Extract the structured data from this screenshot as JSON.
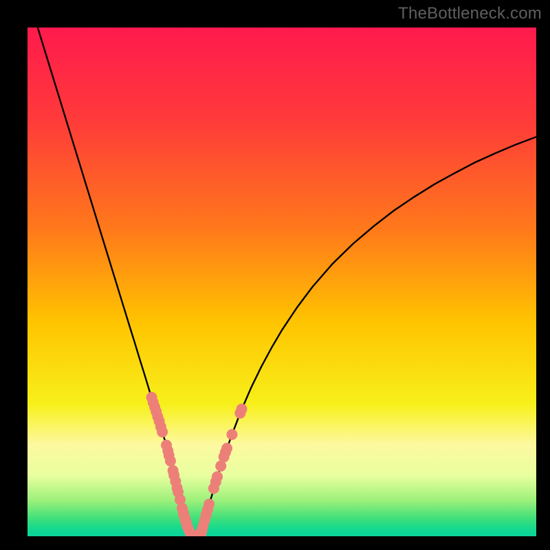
{
  "watermark": "TheBottleneck.com",
  "chart_data": {
    "type": "line",
    "title": "",
    "xlabel": "",
    "ylabel": "",
    "xlim": [
      0,
      100
    ],
    "ylim": [
      0,
      100
    ],
    "background_gradient": {
      "stops": [
        {
          "offset": 0.0,
          "color": "#ff1a4d"
        },
        {
          "offset": 0.18,
          "color": "#ff3a3a"
        },
        {
          "offset": 0.4,
          "color": "#ff7a1a"
        },
        {
          "offset": 0.58,
          "color": "#ffc400"
        },
        {
          "offset": 0.74,
          "color": "#f7f01a"
        },
        {
          "offset": 0.82,
          "color": "#fdf9a0"
        },
        {
          "offset": 0.88,
          "color": "#e9ff9f"
        },
        {
          "offset": 0.93,
          "color": "#9cf07a"
        },
        {
          "offset": 0.965,
          "color": "#3fe07a"
        },
        {
          "offset": 0.985,
          "color": "#14d98f"
        },
        {
          "offset": 1.0,
          "color": "#0bd39b"
        }
      ]
    },
    "series": [
      {
        "name": "left-branch",
        "x": [
          2,
          4,
          6,
          8,
          10,
          12,
          14,
          16,
          18,
          20,
          21,
          22,
          23,
          24,
          25,
          25.8,
          26.5,
          27.2,
          27.8,
          28.3,
          28.8,
          29.2,
          29.6,
          30.0,
          30.3,
          30.6,
          30.9,
          31.2,
          31.4,
          31.7,
          31.9,
          32.1,
          32.3
        ],
        "values": [
          100,
          93.5,
          87,
          80.5,
          74,
          67.5,
          61,
          54.5,
          48,
          41.5,
          38.3,
          35,
          31.8,
          28.5,
          25.3,
          22.9,
          20.5,
          18.2,
          15.9,
          13.9,
          12,
          10.3,
          8.7,
          7.2,
          5.9,
          4.7,
          3.6,
          2.7,
          1.9,
          1.2,
          0.7,
          0.3,
          0.05
        ]
      },
      {
        "name": "right-branch",
        "x": [
          34.0,
          34.4,
          34.9,
          35.5,
          36.2,
          37.0,
          38.0,
          40,
          42,
          44,
          46,
          48,
          50,
          53,
          56,
          60,
          64,
          68,
          72,
          76,
          80,
          84,
          88,
          92,
          96,
          100
        ],
        "values": [
          0.05,
          1.6,
          3.4,
          5.5,
          7.9,
          10.6,
          13.7,
          19.5,
          24.7,
          29.3,
          33.4,
          37.1,
          40.5,
          45.0,
          49.0,
          53.6,
          57.5,
          60.9,
          64.0,
          66.7,
          69.2,
          71.4,
          73.5,
          75.3,
          77.0,
          78.5
        ]
      }
    ],
    "valley_floor": {
      "x": [
        32.3,
        34.0
      ],
      "y": 0.05
    },
    "markers": [
      {
        "branch": "left",
        "x": 24.4,
        "y": 27.3
      },
      {
        "branch": "left",
        "x": 24.7,
        "y": 26.3
      },
      {
        "branch": "left",
        "x": 25.0,
        "y": 25.4
      },
      {
        "branch": "left",
        "x": 25.3,
        "y": 24.5
      },
      {
        "branch": "left",
        "x": 25.6,
        "y": 23.5
      },
      {
        "branch": "left",
        "x": 25.9,
        "y": 22.6
      },
      {
        "branch": "left",
        "x": 26.2,
        "y": 21.5
      },
      {
        "branch": "left",
        "x": 26.5,
        "y": 20.5
      },
      {
        "branch": "left",
        "x": 27.3,
        "y": 17.9
      },
      {
        "branch": "left",
        "x": 27.6,
        "y": 16.8
      },
      {
        "branch": "left",
        "x": 27.8,
        "y": 15.9
      },
      {
        "branch": "left",
        "x": 28.1,
        "y": 14.8
      },
      {
        "branch": "left",
        "x": 28.6,
        "y": 12.9
      },
      {
        "branch": "left",
        "x": 28.8,
        "y": 12.0
      },
      {
        "branch": "left",
        "x": 29.1,
        "y": 10.8
      },
      {
        "branch": "left",
        "x": 29.4,
        "y": 9.5
      },
      {
        "branch": "left",
        "x": 29.6,
        "y": 8.7
      },
      {
        "branch": "left",
        "x": 30.0,
        "y": 7.2
      },
      {
        "branch": "left",
        "x": 30.4,
        "y": 5.5
      },
      {
        "branch": "left",
        "x": 30.6,
        "y": 4.7
      },
      {
        "branch": "left",
        "x": 30.8,
        "y": 4.0
      },
      {
        "branch": "left",
        "x": 31.0,
        "y": 3.3
      },
      {
        "branch": "left",
        "x": 31.2,
        "y": 2.7
      },
      {
        "branch": "left",
        "x": 31.4,
        "y": 2.0
      },
      {
        "branch": "left",
        "x": 31.6,
        "y": 1.5
      },
      {
        "branch": "left",
        "x": 31.8,
        "y": 1.0
      },
      {
        "branch": "left",
        "x": 32.0,
        "y": 0.6
      },
      {
        "branch": "left",
        "x": 32.2,
        "y": 0.3
      },
      {
        "branch": "floor",
        "x": 32.5,
        "y": 0.05
      },
      {
        "branch": "floor",
        "x": 32.9,
        "y": 0.05
      },
      {
        "branch": "floor",
        "x": 33.3,
        "y": 0.05
      },
      {
        "branch": "floor",
        "x": 33.7,
        "y": 0.05
      },
      {
        "branch": "right",
        "x": 34.1,
        "y": 0.4
      },
      {
        "branch": "right",
        "x": 34.3,
        "y": 1.2
      },
      {
        "branch": "right",
        "x": 34.5,
        "y": 2.0
      },
      {
        "branch": "right",
        "x": 34.8,
        "y": 3.1
      },
      {
        "branch": "right",
        "x": 35.1,
        "y": 4.2
      },
      {
        "branch": "right",
        "x": 35.4,
        "y": 5.2
      },
      {
        "branch": "right",
        "x": 35.7,
        "y": 6.3
      },
      {
        "branch": "right",
        "x": 36.6,
        "y": 9.4
      },
      {
        "branch": "right",
        "x": 37.0,
        "y": 10.7
      },
      {
        "branch": "right",
        "x": 37.3,
        "y": 11.7
      },
      {
        "branch": "right",
        "x": 38.0,
        "y": 13.8
      },
      {
        "branch": "right",
        "x": 38.6,
        "y": 15.6
      },
      {
        "branch": "right",
        "x": 38.9,
        "y": 16.5
      },
      {
        "branch": "right",
        "x": 39.2,
        "y": 17.3
      },
      {
        "branch": "right",
        "x": 40.2,
        "y": 20.0
      },
      {
        "branch": "right",
        "x": 41.8,
        "y": 24.2
      },
      {
        "branch": "right",
        "x": 42.1,
        "y": 25.0
      }
    ],
    "marker_style": {
      "fill": "#ec8079",
      "radius_px": 8
    }
  }
}
